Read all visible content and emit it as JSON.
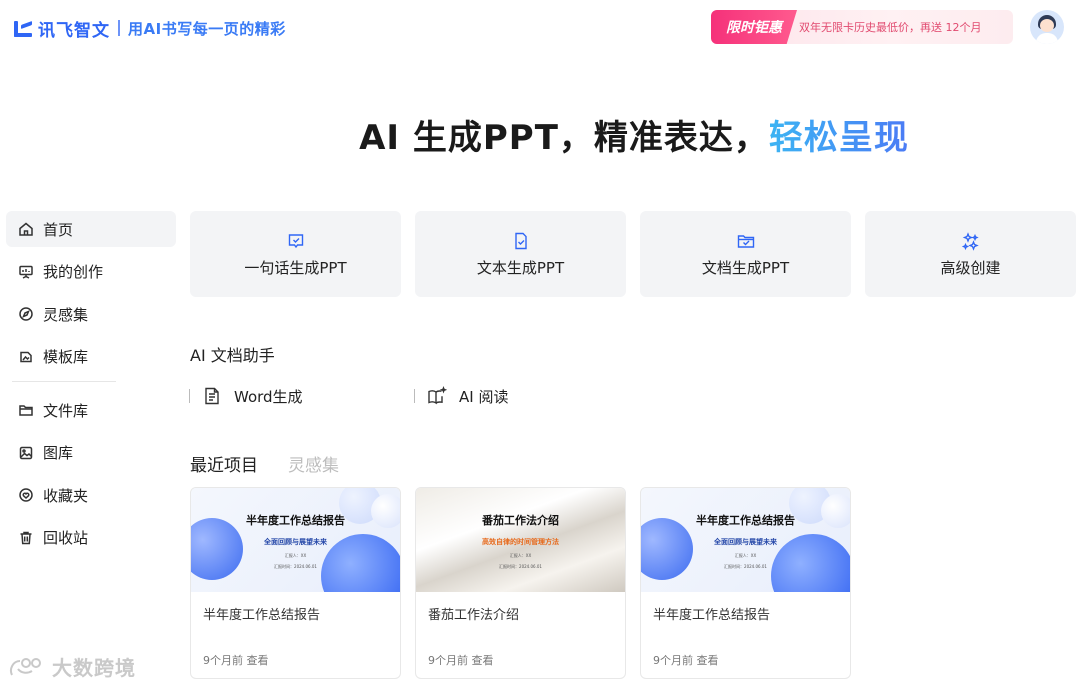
{
  "header": {
    "logo_text": "讯飞智文",
    "slogan": "用AI书写每一页的精彩",
    "promo_tag": "限时钜惠",
    "promo_text": "双年无限卡历史最低价，再送 12个月",
    "brand_color": "#2f66f5",
    "promo_color": "#f5317a"
  },
  "hero": {
    "text_main": "AI 生成PPT，精准表达，",
    "text_highlight": "轻松呈现"
  },
  "sidebar": {
    "items": [
      {
        "label": "首页",
        "icon": "home-icon"
      },
      {
        "label": "我的创作",
        "icon": "presentation-icon"
      },
      {
        "label": "灵感集",
        "icon": "compass-icon"
      },
      {
        "label": "模板库",
        "icon": "template-icon"
      },
      {
        "label": "文件库",
        "icon": "folder-icon"
      },
      {
        "label": "图库",
        "icon": "image-icon"
      },
      {
        "label": "收藏夹",
        "icon": "favorite-icon"
      },
      {
        "label": "回收站",
        "icon": "trash-icon"
      }
    ]
  },
  "actions": [
    {
      "label": "一句话生成PPT",
      "icon": "chat-check-icon"
    },
    {
      "label": "文本生成PPT",
      "icon": "document-check-icon"
    },
    {
      "label": "文档生成PPT",
      "icon": "folder-check-icon"
    },
    {
      "label": "高级创建",
      "icon": "sparkle-icon"
    }
  ],
  "assistant": {
    "title": "AI 文档助手",
    "tools": [
      {
        "label": "Word生成",
        "icon": "word-doc-icon"
      },
      {
        "label": "AI 阅读",
        "icon": "book-ai-icon"
      }
    ]
  },
  "recent": {
    "tab_active": "最近项目",
    "tab_other": "灵感集",
    "projects": [
      {
        "name": "半年度工作总结报告",
        "meta": "9个月前 查看",
        "thumb_title": "半年度工作总结报告",
        "thumb_sub": "全面回顾与展望未来",
        "thumb_l3": "汇报人：XX",
        "thumb_l4": "汇报时间：2024.06.01"
      },
      {
        "name": "番茄工作法介绍",
        "meta": "9个月前 查看",
        "thumb_title": "番茄工作法介绍",
        "thumb_sub": "高效自律的时间管理方法",
        "thumb_l3": "汇报人：XX",
        "thumb_l4": "汇报时间：2024.06.01"
      },
      {
        "name": "半年度工作总结报告",
        "meta": "9个月前 查看",
        "thumb_title": "半年度工作总结报告",
        "thumb_sub": "全面回顾与展望未来",
        "thumb_l3": "汇报人：XX",
        "thumb_l4": "汇报时间：2024.06.01"
      }
    ]
  },
  "watermark": "大数跨境"
}
